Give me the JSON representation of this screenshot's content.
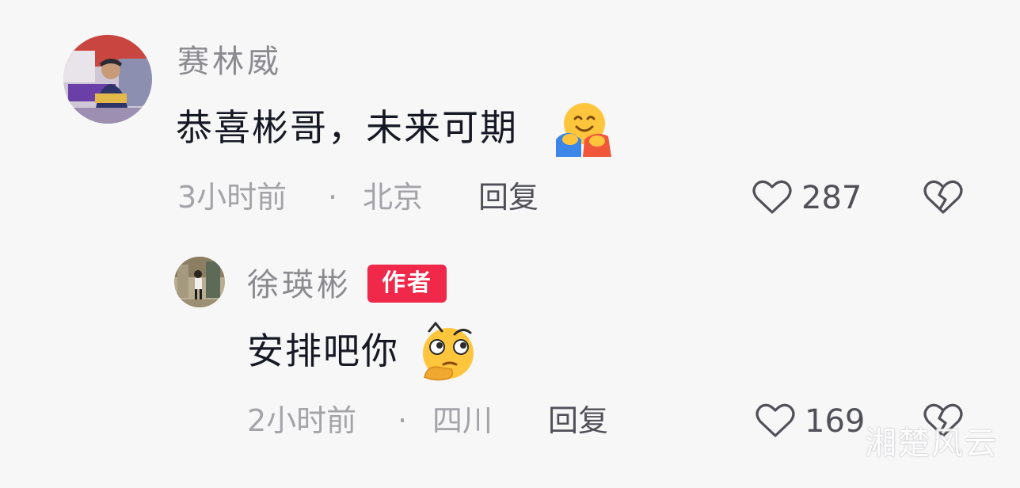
{
  "comments": [
    {
      "username": "赛林威",
      "text": "恭喜彬哥，未来可期",
      "emoji": "hugging-face-emoji",
      "time": "3小时前",
      "separator": "·",
      "location": "北京",
      "reply_label": "回复",
      "like_count": "287",
      "icons": {
        "like": "heart-outline-icon",
        "dislike": "broken-heart-icon"
      }
    },
    {
      "username": "徐瑛彬",
      "badge": "作者",
      "text": "安排吧你",
      "emoji": "thinking-face-emoji",
      "time": "2小时前",
      "separator": "·",
      "location": "四川",
      "reply_label": "回复",
      "like_count": "169",
      "icons": {
        "like": "heart-outline-icon",
        "dislike": "broken-heart-icon"
      }
    }
  ],
  "watermark": "湘楚风云",
  "colors": {
    "background": "#f7f7f8",
    "username": "#8a8a8f",
    "text": "#161823",
    "meta": "#a3a3a8",
    "action": "#505058",
    "badge": "#f0284a"
  }
}
